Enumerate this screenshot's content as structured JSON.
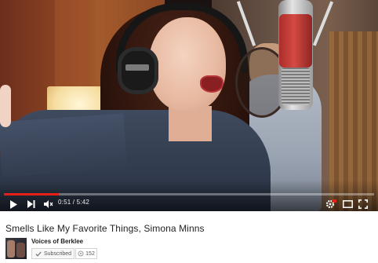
{
  "player": {
    "current_time": "0:51",
    "duration": "5:42",
    "time_display": "0:51 / 5:42",
    "progress_fraction": 0.149,
    "accent_color": "#e52117",
    "icons": [
      "play-icon",
      "next-icon",
      "volume-icon",
      "settings-icon",
      "theater-icon",
      "fullscreen-icon"
    ],
    "settings_badge": "HD"
  },
  "video": {
    "title": "Smells Like My Favorite Things, Simona Minns"
  },
  "channel": {
    "name": "Voices of Berklee",
    "subscribe_label": "Subscribed",
    "subscriber_count": "152"
  }
}
